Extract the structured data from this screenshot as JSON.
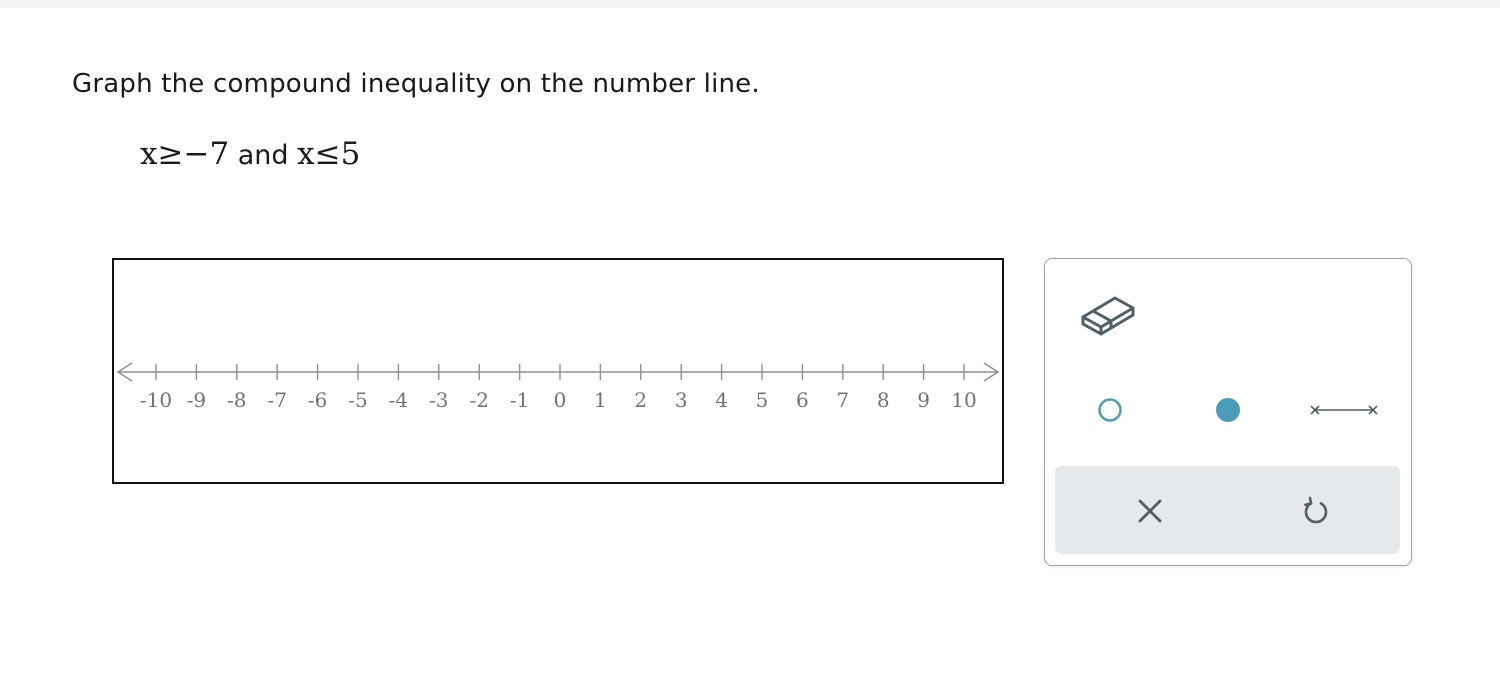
{
  "instruction": "Graph the compound inequality on the number line.",
  "problem": {
    "var1": "x",
    "op1": "≥",
    "value1": "−7",
    "conjunction": "and",
    "var2": "x",
    "op2": "≤",
    "value2": "5"
  },
  "number_line": {
    "min": -10,
    "max": 10,
    "step": 1,
    "tick_labels": [
      "-10",
      "-9",
      "-8",
      "-7",
      "-6",
      "-5",
      "-4",
      "-3",
      "-2",
      "-1",
      "0",
      "1",
      "2",
      "3",
      "4",
      "5",
      "6",
      "7",
      "8",
      "9",
      "10"
    ]
  },
  "tools": {
    "eraser": "eraser-icon",
    "open_point": "open-circle-icon",
    "closed_point": "closed-circle-icon",
    "segment": "segment-icon"
  },
  "actions": {
    "clear": "close-icon",
    "undo": "undo-icon"
  },
  "colors": {
    "accent": "#4a9cb8",
    "icon": "#4f5f67",
    "axis": "#8a9196",
    "tick_label": "#6e7478"
  }
}
